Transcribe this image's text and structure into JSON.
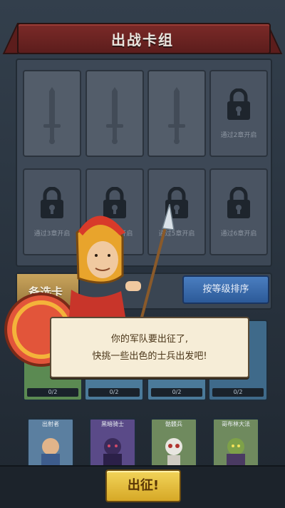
{
  "title": "出战卡组",
  "deck": {
    "unlock_labels": [
      "通过2章开启",
      "通过3章开启",
      "通过4章开启",
      "通过5章开启",
      "通过6章开启"
    ]
  },
  "reserve": {
    "label": "备选卡",
    "sort_button": "按等级排序",
    "card_counts": [
      "0/2",
      "0/2",
      "0/2",
      "0/2"
    ],
    "bottom_cards": [
      "出射者",
      "黑暗骑士",
      "骷髅兵",
      "哥布林大法"
    ]
  },
  "dialog": {
    "line1": "你的军队要出征了,",
    "line2": "快挑一些出色的士兵出发吧!"
  },
  "go_button": "出征!",
  "colors": {
    "banner": "#7b2a28",
    "go_button": "#f2d45a",
    "sort_button": "#2c5a98"
  }
}
